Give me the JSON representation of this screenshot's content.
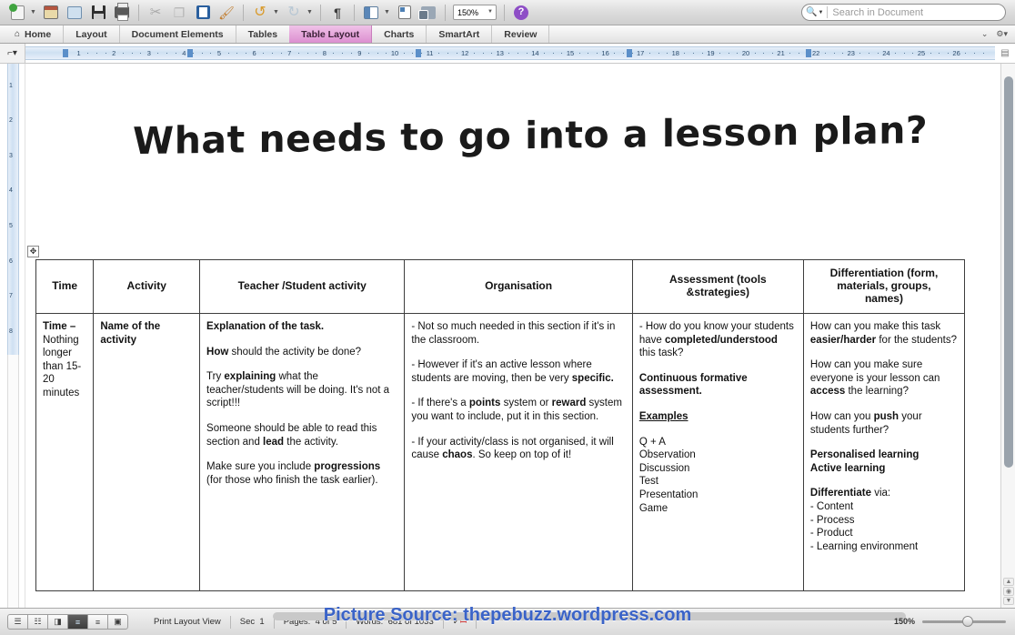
{
  "toolbar": {
    "icons": [
      {
        "name": "new-document-icon",
        "label": "New"
      },
      {
        "name": "new-from-template-icon",
        "label": "New from template"
      },
      {
        "name": "open-document-icon",
        "label": "Open"
      },
      {
        "name": "save-icon",
        "label": "Save"
      },
      {
        "name": "print-icon",
        "label": "Print"
      },
      {
        "name": "cut-icon",
        "label": "Cut"
      },
      {
        "name": "copy-icon",
        "label": "Copy"
      },
      {
        "name": "paste-icon",
        "label": "Paste"
      },
      {
        "name": "format-painter-icon",
        "label": "Format"
      },
      {
        "name": "undo-icon",
        "label": "Undo"
      },
      {
        "name": "redo-icon",
        "label": "Redo"
      },
      {
        "name": "show-formatting-marks-icon",
        "label": "Show all nonprinting characters"
      },
      {
        "name": "sidebar-icon",
        "label": "Sidebar"
      },
      {
        "name": "notebook-icon",
        "label": "Notebook"
      },
      {
        "name": "media-gallery-icon",
        "label": "Media Browser"
      },
      {
        "name": "help-icon",
        "label": "Help"
      }
    ],
    "zoom_value": "150%"
  },
  "search": {
    "placeholder": "Search in Document",
    "icon": "search-icon"
  },
  "ribbon": {
    "tabs": [
      {
        "label": "Home",
        "active": false,
        "icon": "home-icon"
      },
      {
        "label": "Layout",
        "active": false
      },
      {
        "label": "Document Elements",
        "active": false
      },
      {
        "label": "Tables",
        "active": false
      },
      {
        "label": "Table Layout",
        "active": true
      },
      {
        "label": "Charts",
        "active": false
      },
      {
        "label": "SmartArt",
        "active": false
      },
      {
        "label": "Review",
        "active": false
      }
    ],
    "collapse_icon": "chevron-down-icon",
    "settings_icon": "gear-icon"
  },
  "ruler": {
    "horizontal_marks": [
      1,
      2,
      3,
      4,
      5,
      6,
      7,
      8,
      9,
      10,
      11,
      12,
      13,
      14,
      15,
      16,
      17,
      18,
      19,
      20,
      21,
      22,
      23,
      24,
      25,
      26
    ],
    "vertical_marks": [
      1,
      2,
      3,
      4,
      5,
      6,
      7,
      8
    ]
  },
  "document": {
    "heading": "What needs to go into a lesson plan?",
    "table": {
      "headers": [
        "Time",
        "Activity",
        "Teacher /Student activity",
        "Organisation",
        "Assessment (tools &strategies)",
        "Differentiation (form, materials, groups, names)"
      ],
      "header_lines": {
        "assessment": [
          "Assessment (tools",
          "&strategies)"
        ],
        "differentiation": [
          "Differentiation (form,",
          "materials, groups,",
          "names)"
        ]
      },
      "cells": {
        "time": [
          {
            "bold_prefix": "Time – ",
            "rest": "Nothing longer than 15-20 minutes"
          }
        ],
        "activity": [
          {
            "bold_all": "Name of the activity"
          }
        ],
        "teacher_student": [
          {
            "runs": [
              {
                "t": "Explanation of the task.",
                "b": true
              }
            ]
          },
          {
            "runs": [
              {
                "t": "How",
                "b": true
              },
              {
                "t": " should the activity be done?",
                "b": false
              }
            ]
          },
          {
            "runs": [
              {
                "t": "Try ",
                "b": false
              },
              {
                "t": "explaining",
                "b": true
              },
              {
                "t": " what the teacher/students will be doing. It's not a script!!!",
                "b": false
              }
            ]
          },
          {
            "runs": [
              {
                "t": "Someone should be able to read this section and ",
                "b": false
              },
              {
                "t": "lead",
                "b": true
              },
              {
                "t": " the activity.",
                "b": false
              }
            ]
          },
          {
            "runs": [
              {
                "t": "Make sure you include ",
                "b": false
              },
              {
                "t": "progressions",
                "b": true
              },
              {
                "t": " (for those who finish the task earlier).",
                "b": false
              }
            ]
          }
        ],
        "organisation": [
          {
            "runs": [
              {
                "t": "- Not so much needed in this section if it's in the classroom.",
                "b": false
              }
            ]
          },
          {
            "runs": [
              {
                "t": "- However if it's an active lesson where students are moving, then be very ",
                "b": false
              },
              {
                "t": "specific.",
                "b": true
              }
            ]
          },
          {
            "runs": [
              {
                "t": "- If there's a ",
                "b": false
              },
              {
                "t": "points",
                "b": true
              },
              {
                "t": " system or ",
                "b": false
              },
              {
                "t": "reward",
                "b": true
              },
              {
                "t": " system you want to include, put it in this section.",
                "b": false
              }
            ]
          },
          {
            "runs": [
              {
                "t": "- If your activity/class is not organised, it will cause ",
                "b": false
              },
              {
                "t": "chaos",
                "b": true
              },
              {
                "t": ". So keep on top of it!",
                "b": false
              }
            ]
          }
        ],
        "assessment": [
          {
            "runs": [
              {
                "t": "- How do you know your students have ",
                "b": false
              },
              {
                "t": "completed/understood",
                "b": true
              },
              {
                "t": " this task?",
                "b": false
              }
            ]
          },
          {
            "runs": [
              {
                "t": "Continuous formative assessment.",
                "b": true
              }
            ]
          },
          {
            "runs": [
              {
                "t": "Examples",
                "b": true,
                "u": true
              }
            ]
          },
          {
            "runs": [
              {
                "t": "Q + A",
                "b": false
              }
            ]
          },
          {
            "runs": [
              {
                "t": "Observation",
                "b": false
              }
            ]
          },
          {
            "runs": [
              {
                "t": "Discussion",
                "b": false
              }
            ]
          },
          {
            "runs": [
              {
                "t": "Test",
                "b": false
              }
            ]
          },
          {
            "runs": [
              {
                "t": "Presentation",
                "b": false
              }
            ]
          },
          {
            "runs": [
              {
                "t": "Game",
                "b": false
              }
            ]
          }
        ],
        "differentiation": [
          {
            "runs": [
              {
                "t": "How can you make this task ",
                "b": false
              },
              {
                "t": "easier/harder",
                "b": true
              },
              {
                "t": " for the students?",
                "b": false
              }
            ]
          },
          {
            "runs": [
              {
                "t": "How can you make sure everyone is your lesson can ",
                "b": false
              },
              {
                "t": "access",
                "b": true
              },
              {
                "t": " the learning?",
                "b": false
              }
            ]
          },
          {
            "runs": [
              {
                "t": "How can you ",
                "b": false
              },
              {
                "t": "push",
                "b": true
              },
              {
                "t": " your students further?",
                "b": false
              }
            ]
          },
          {
            "runs": [
              {
                "t": "Personalised learning",
                "b": true
              }
            ]
          },
          {
            "runs": [
              {
                "t": "Active learning",
                "b": true
              }
            ]
          },
          {
            "runs": [
              {
                "t": "Differentiate",
                "b": true
              },
              {
                "t": " via:",
                "b": false
              }
            ]
          },
          {
            "runs": [
              {
                "t": "- Content",
                "b": false
              }
            ]
          },
          {
            "runs": [
              {
                "t": "- Process",
                "b": false
              }
            ]
          },
          {
            "runs": [
              {
                "t": "- Product",
                "b": false
              }
            ]
          },
          {
            "runs": [
              {
                "t": "- Learning environment",
                "b": false
              }
            ]
          }
        ]
      }
    }
  },
  "statusbar": {
    "view_buttons": [
      {
        "name": "draft-view-button",
        "glyph": "☰",
        "selected": false
      },
      {
        "name": "outline-view-button",
        "glyph": "☷",
        "selected": false
      },
      {
        "name": "publishing-layout-view-button",
        "glyph": "◨",
        "selected": false
      },
      {
        "name": "print-layout-view-button",
        "glyph": "≡",
        "selected": true
      },
      {
        "name": "notebook-layout-view-button",
        "glyph": "≡",
        "selected": false
      },
      {
        "name": "focus-view-button",
        "glyph": "▣",
        "selected": false
      }
    ],
    "view_label": "Print Layout View",
    "sec_label": "Sec",
    "sec_value": "1",
    "pages_label": "Pages:",
    "pages_value": "4 of 5",
    "words_label": "Words:",
    "words_value": "681 of 1033",
    "spellcheck_icon": "spellcheck-icon",
    "zoom_label": "150%"
  },
  "watermark": {
    "text": "Picture Source: thepebuzz.wordpress.com",
    "color": "#3a63c8"
  }
}
